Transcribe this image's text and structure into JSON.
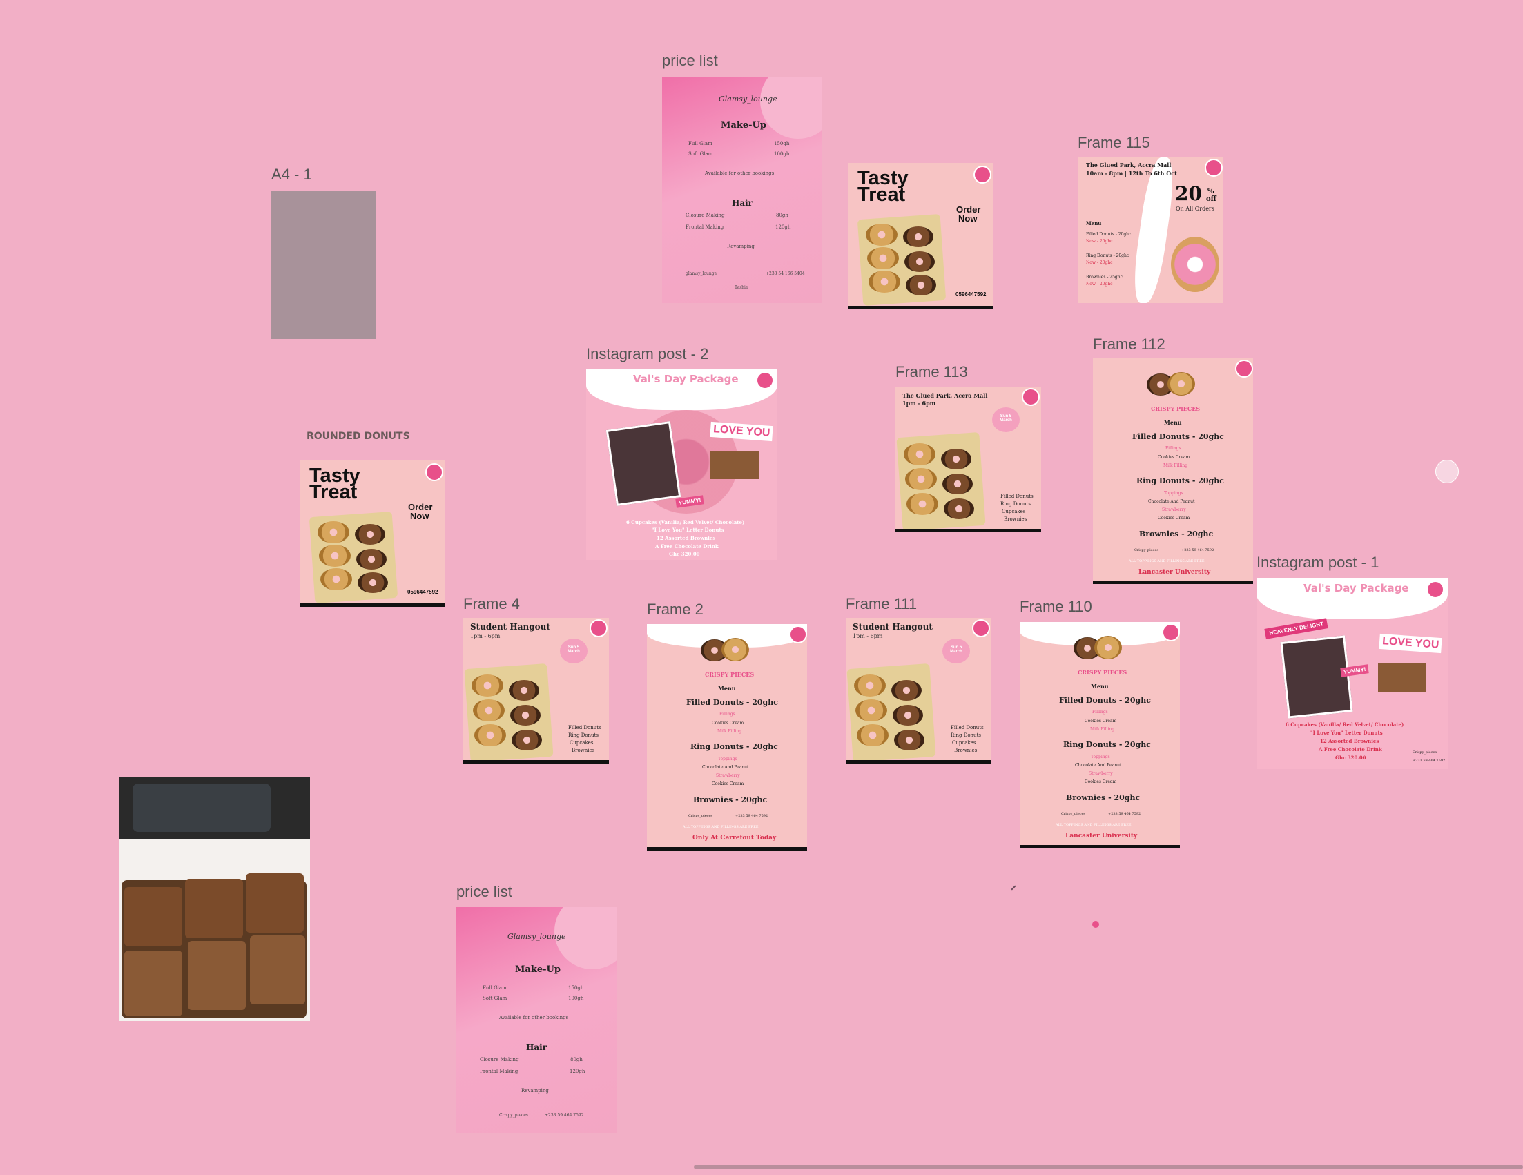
{
  "frames": {
    "a4": {
      "label": "A4 - 1"
    },
    "rounded_donuts": {
      "label": "ROUNDED DONUTS",
      "title_line1": "Tasty",
      "title_line2": "Treat",
      "cta_line1": "Order",
      "cta_line2": "Now",
      "phone": "0596447592"
    },
    "price_list_top": {
      "label": "price list"
    },
    "price_list_bottom": {
      "label": "price list"
    },
    "tasty_treat_mid": {
      "title_line1": "Tasty",
      "title_line2": "Treat",
      "cta_line1": "Order",
      "cta_line2": "Now",
      "phone": "0596447592"
    },
    "frame_115": {
      "label": "Frame 115",
      "loc": "The Glued Park, Accra Mall",
      "hours": "10am - 8pm | 12th To 6th Oct",
      "discount": "20",
      "pct": "%",
      "off": "off",
      "sub": "On All Orders",
      "menu": "Menu",
      "rows": [
        "Filled Donuts - 20ghc",
        "Now - 20ghc",
        "Ring Donuts - 20ghc",
        "Now - 20ghc",
        "Brownies - 25ghc",
        "Now - 20ghc"
      ]
    },
    "ig_post_2": {
      "label": "Instagram post - 2",
      "title": "Val's Day Package",
      "love": "LOVE YOU",
      "yummy": "YUMMY!",
      "lines": [
        "6 Cupcakes (Vanilla/ Red Velvet/ Chocolate)",
        "\"I Love You\" Letter Donuts",
        "12 Assorted Brownies",
        "A Free Chocolate Drink",
        "Ghc 320.00"
      ]
    },
    "frame_113": {
      "label": "Frame 113",
      "loc": "The Glued Park, Accra Mall",
      "hours": "1pm - 6pm",
      "date": "Sun 5 March",
      "items": [
        "Filled Donuts",
        "Ring Donuts",
        "Cupcakes",
        "Brownies"
      ]
    },
    "frame_112": {
      "label": "Frame 112",
      "brand": "CRISPY PIECES",
      "menu": "Menu",
      "filled": "Filled Donuts - 20ghc",
      "fillings": "Fillings",
      "fill_opts": "Cookies  Cream",
      "milk": "Milk Filling",
      "ring": "Ring Donuts - 20ghc",
      "toppings": "Toppings",
      "choc": "Chocolate And Peanut",
      "straw": "Strawberry",
      "ring_opts": "Cookies  Cream",
      "brownies": "Brownies - 20ghc",
      "social": "Crispy_pieces",
      "phone": "+233 59 464 7592",
      "note": "ALL TOPPINGS AND FILLINGS ARE FREE",
      "footer": "Lancaster University"
    },
    "frame_4": {
      "label": "Frame 4",
      "title": "Student Hangout",
      "hours": "1pm - 6pm",
      "date": "Sun 5 March",
      "items": [
        "Filled Donuts",
        "Ring Donuts",
        "Cupcakes",
        "Brownies"
      ]
    },
    "frame_2": {
      "label": "Frame 2",
      "brand": "CRISPY PIECES",
      "menu": "Menu",
      "filled": "Filled Donuts - 20ghc",
      "fillings": "Fillings",
      "fill_opts": "Cookies  Cream",
      "milk": "Milk Filling",
      "ring": "Ring Donuts - 20ghc",
      "toppings": "Toppings",
      "choc": "Chocolate And Peanut",
      "straw": "Strawberry",
      "ring_opts": "Cookies  Cream",
      "brownies": "Brownies - 20ghc",
      "social": "Crispy_pieces",
      "phone": "+233 59 464 7592",
      "note": "ALL TOPPINGS AND FILLINGS ARE FREE",
      "footer": "Only At Carrefout Today"
    },
    "frame_111": {
      "label": "Frame 111",
      "title": "Student Hangout",
      "hours": "1pm - 6pm",
      "date": "Sun 5 March",
      "items": [
        "Filled Donuts",
        "Ring Donuts",
        "Cupcakes",
        "Brownies"
      ]
    },
    "frame_110": {
      "label": "Frame 110",
      "brand": "CRISPY PIECES",
      "menu": "Menu",
      "filled": "Filled Donuts - 20ghc",
      "fillings": "Fillings",
      "fill_opts": "Cookies  Cream",
      "milk": "Milk Filling",
      "ring": "Ring Donuts - 20ghc",
      "toppings": "Toppings",
      "choc": "Chocolate And Peanut",
      "straw": "Strawberry",
      "ring_opts": "Cookies  Cream",
      "brownies": "Brownies - 20ghc",
      "social": "Crispy_pieces",
      "phone": "+233 59 464 7592",
      "note": "ALL TOPPINGS AND FILLINGS ARE FREE",
      "footer": "Lancaster University"
    },
    "ig_post_1": {
      "label": "Instagram post - 1",
      "title": "Val's Day Package",
      "heavenly": "HEAVENLY DELIGHT",
      "love": "LOVE YOU",
      "yummy": "YUMMY!",
      "lines": [
        "6 Cupcakes (Vanilla/ Red Velvet/ Chocolate)",
        "\"I Love You\" Letter Donuts",
        "12 Assorted Brownies",
        "A Free Chocolate Drink",
        "Ghc 320.00"
      ],
      "social": "Crispy_pieces",
      "phone": "+233 59 464 7592"
    }
  },
  "price_list": {
    "brand": "Glamsy_lounge",
    "makeup": "Make-Up",
    "full_glam": "Full Glam",
    "full_glam_price": "150gh",
    "soft_glam": "Soft Glam",
    "soft_glam_price": "100gh",
    "available": "Available for other bookings",
    "hair": "Hair",
    "closure": "Closure Making",
    "closure_price": "80gh",
    "frontal": "Frontal Making",
    "frontal_price": "120gh",
    "revamping": "Revamping",
    "social": "glamsy_lounge",
    "phone": "+233 54 166 5404",
    "location": "Teshie",
    "social_b": "Crispy_pieces",
    "phone_b": "+233 59 464 7592"
  },
  "colors": {
    "canvas": "#f2afc6",
    "card": "#f7c4c4",
    "brand": "#e8508a",
    "red": "#d9304f"
  }
}
